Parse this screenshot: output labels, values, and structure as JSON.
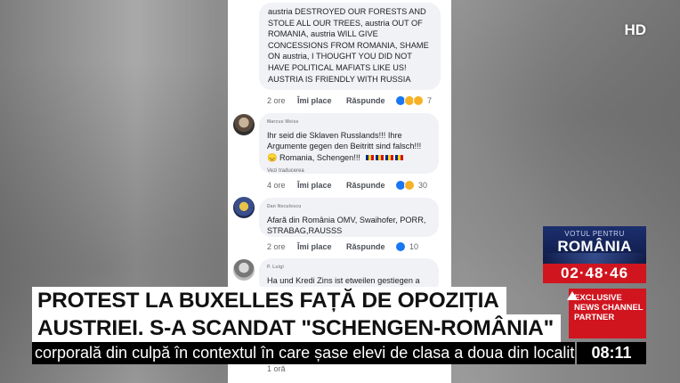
{
  "badge": {
    "hd": "HD"
  },
  "comments": [
    {
      "author": "",
      "text": "austria DESTROYED OUR FORESTS AND STOLE ALL OUR TREES, austria OUT OF ROMANIA, austria WILL GIVE CONCESSIONS FROM ROMANIA, SHAME ON austria, I THOUGHT YOU DID NOT HAVE POLITICAL MAFIATS LIKE US! AUSTRIA IS FRIENDLY WITH RUSSIA",
      "time": "2 ore",
      "like": "Îmi place",
      "reply": "Răspunde",
      "reactions": "7"
    },
    {
      "author": "Marcus Weiss",
      "text": "Ihr seid die Sklaven Russlands!!! Ihre Argumente gegen den Beitritt sind falsch!!!",
      "text2": "Romania, Schengen!!!",
      "translate": "Vezi traducerea",
      "time": "4 ore",
      "like": "Îmi place",
      "reply": "Răspunde",
      "reactions": "30"
    },
    {
      "author": "Dan Neculescu",
      "text": "Afară din România OMV, Swaihofer, PORR, STRABAG,RAUSSS",
      "time": "2 ore",
      "like": "Îmi place",
      "reply": "Răspunde",
      "reactions": "10"
    },
    {
      "author": "P. Luigi",
      "text": "Ha und Kredi Zins ist etweilen gestiegen a",
      "time": "1 oră"
    }
  ],
  "headline": {
    "line1": "PROTEST LA BUXELLES FAȚĂ DE OPOZIȚIA",
    "line2": "AUSTRIEI. S-A SCANDAT \"SCHENGEN-ROMÂNIA\""
  },
  "ticker": {
    "text": "corporală din culpă în contextul în care șase elevi de clasa a doua din localitatea Dob"
  },
  "clock": "08:11",
  "vote": {
    "label": "VOTUL PENTRU",
    "country": "ROMÂNIA",
    "countdown": "02·48·46"
  },
  "partner": {
    "line1": "EXCLUSIVE",
    "line2": "NEWS CHANNEL",
    "line3": "PARTNER"
  },
  "colors": {
    "brand_red": "#d0151f",
    "fb_blue": "#1877f2",
    "vote_blue": "#1c2f6e"
  }
}
